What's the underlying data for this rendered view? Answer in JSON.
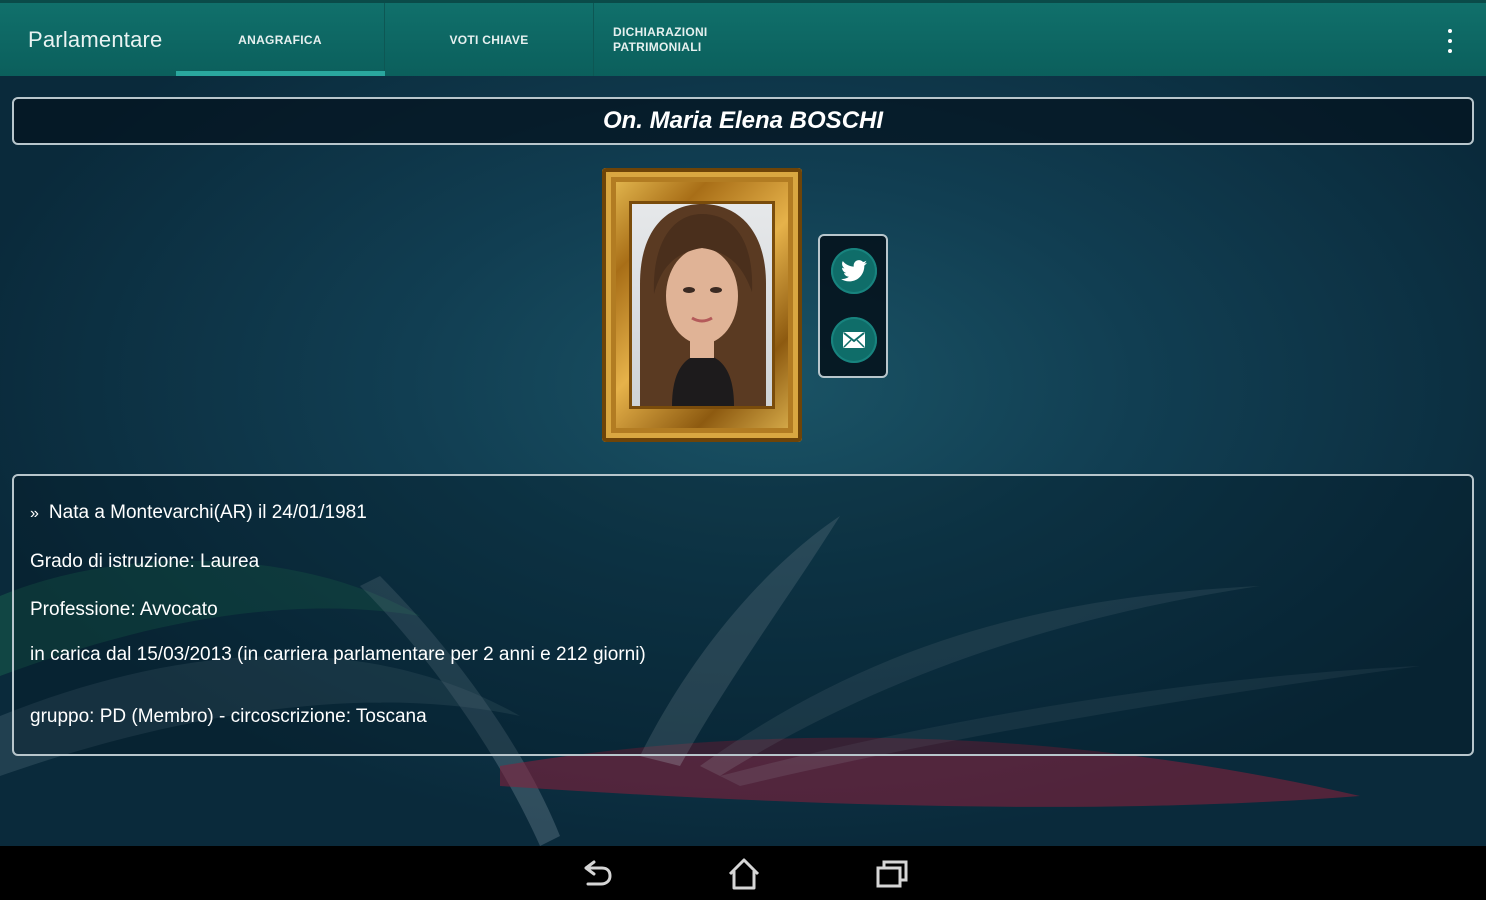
{
  "app_bar": {
    "title": "Parlamentare",
    "tabs": [
      {
        "label": "ANAGRAFICA",
        "selected": true
      },
      {
        "label": "VOTI CHIAVE",
        "selected": false
      },
      {
        "label_line1": "DICHIARAZIONI",
        "label_line2": "PATRIMONIALI",
        "selected": false
      }
    ],
    "overflow_icon": "more-vertical-icon"
  },
  "profile": {
    "name": "On. Maria Elena BOSCHI",
    "social": {
      "twitter_icon": "twitter-icon",
      "email_icon": "email-icon"
    }
  },
  "info": {
    "birth": "Nata a Montevarchi(AR) il 24/01/1981",
    "education": "Grado di istruzione: Laurea",
    "profession": "Professione: Avvocato",
    "in_office": "in carica dal 15/03/2013 (in carriera parlamentare per 2 anni e 212 giorni)",
    "group": "gruppo: PD (Membro) - circoscrizione: Toscana"
  },
  "nav_bar": {
    "back_icon": "back-icon",
    "home_icon": "home-icon",
    "recents_icon": "recents-icon"
  },
  "colors": {
    "app_bar": "#0b5f5c",
    "tab_indicator": "#2aa79e",
    "background": "#0b2a3c",
    "frame_gold": "#d9a741"
  }
}
